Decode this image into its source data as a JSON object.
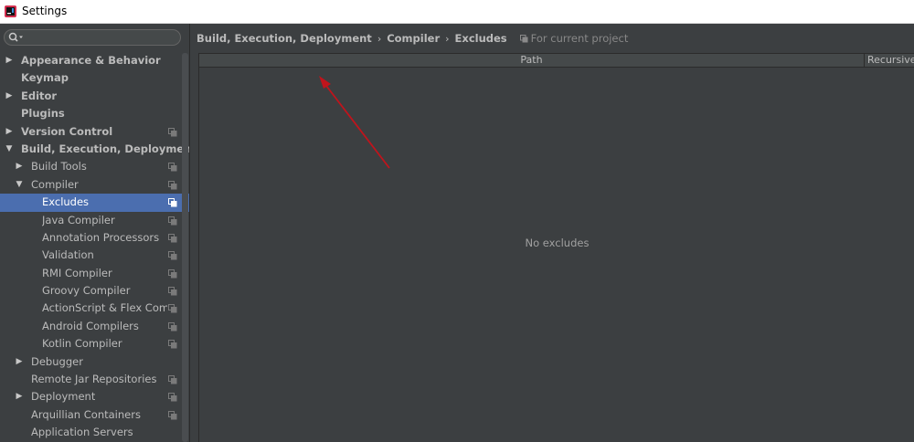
{
  "window": {
    "title": "Settings"
  },
  "search": {
    "value": "",
    "placeholder": ""
  },
  "sidebar": {
    "items": [
      {
        "label": "Appearance & Behavior",
        "level": 0,
        "arrow": "▶",
        "bold": true,
        "copy": false,
        "selected": false
      },
      {
        "label": "Keymap",
        "level": 0,
        "arrow": "",
        "bold": true,
        "copy": false,
        "selected": false
      },
      {
        "label": "Editor",
        "level": 0,
        "arrow": "▶",
        "bold": true,
        "copy": false,
        "selected": false
      },
      {
        "label": "Plugins",
        "level": 0,
        "arrow": "",
        "bold": true,
        "copy": false,
        "selected": false
      },
      {
        "label": "Version Control",
        "level": 0,
        "arrow": "▶",
        "bold": true,
        "copy": true,
        "selected": false
      },
      {
        "label": "Build, Execution, Deployment",
        "level": 0,
        "arrow": "▼",
        "bold": true,
        "copy": false,
        "selected": false
      },
      {
        "label": "Build Tools",
        "level": 1,
        "arrow": "▶",
        "bold": false,
        "copy": true,
        "selected": false
      },
      {
        "label": "Compiler",
        "level": 1,
        "arrow": "▼",
        "bold": false,
        "copy": true,
        "selected": false
      },
      {
        "label": "Excludes",
        "level": 2,
        "arrow": "",
        "bold": false,
        "copy": true,
        "selected": true
      },
      {
        "label": "Java Compiler",
        "level": 2,
        "arrow": "",
        "bold": false,
        "copy": true,
        "selected": false
      },
      {
        "label": "Annotation Processors",
        "level": 2,
        "arrow": "",
        "bold": false,
        "copy": true,
        "selected": false
      },
      {
        "label": "Validation",
        "level": 2,
        "arrow": "",
        "bold": false,
        "copy": true,
        "selected": false
      },
      {
        "label": "RMI Compiler",
        "level": 2,
        "arrow": "",
        "bold": false,
        "copy": true,
        "selected": false
      },
      {
        "label": "Groovy Compiler",
        "level": 2,
        "arrow": "",
        "bold": false,
        "copy": true,
        "selected": false
      },
      {
        "label": "ActionScript & Flex Compil",
        "level": 2,
        "arrow": "",
        "bold": false,
        "copy": true,
        "selected": false
      },
      {
        "label": "Android Compilers",
        "level": 2,
        "arrow": "",
        "bold": false,
        "copy": true,
        "selected": false
      },
      {
        "label": "Kotlin Compiler",
        "level": 2,
        "arrow": "",
        "bold": false,
        "copy": true,
        "selected": false
      },
      {
        "label": "Debugger",
        "level": 1,
        "arrow": "▶",
        "bold": false,
        "copy": false,
        "selected": false
      },
      {
        "label": "Remote Jar Repositories",
        "level": 1,
        "arrow": "",
        "bold": false,
        "copy": true,
        "selected": false
      },
      {
        "label": "Deployment",
        "level": 1,
        "arrow": "▶",
        "bold": false,
        "copy": true,
        "selected": false
      },
      {
        "label": "Arquillian Containers",
        "level": 1,
        "arrow": "",
        "bold": false,
        "copy": true,
        "selected": false
      },
      {
        "label": "Application Servers",
        "level": 1,
        "arrow": "",
        "bold": false,
        "copy": false,
        "selected": false
      }
    ]
  },
  "breadcrumb": {
    "items": [
      "Build, Execution, Deployment",
      "Compiler",
      "Excludes"
    ],
    "separator": "›",
    "scope_label": "For current project"
  },
  "table": {
    "columns": [
      "Path",
      "Recursively"
    ],
    "empty_text": "No excludes"
  },
  "colors": {
    "background": "#3c3f41",
    "selection": "#4b6eaf",
    "annotation_arrow": "#c0141c"
  }
}
